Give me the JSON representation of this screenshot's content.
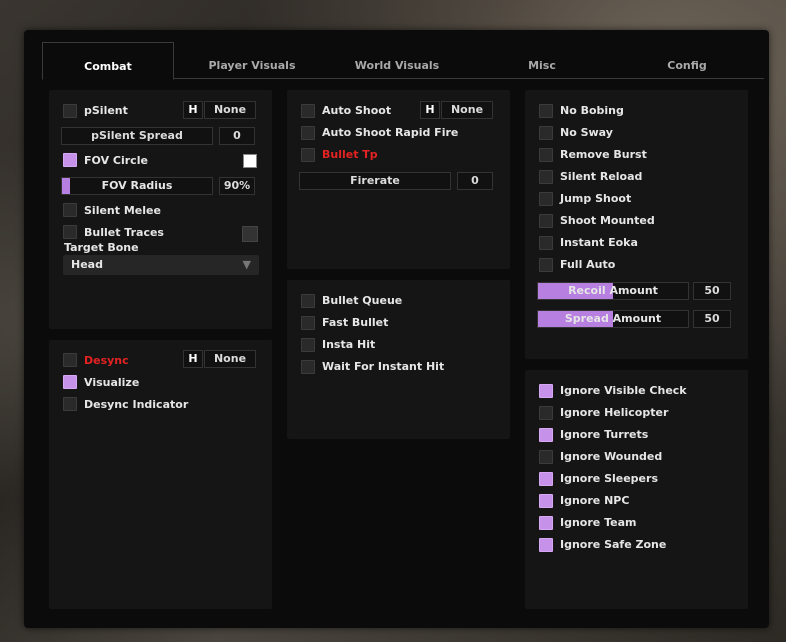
{
  "tabs": [
    {
      "label": "Combat",
      "active": true
    },
    {
      "label": "Player Visuals",
      "active": false
    },
    {
      "label": "World Visuals",
      "active": false
    },
    {
      "label": "Misc",
      "active": false
    },
    {
      "label": "Config",
      "active": false
    }
  ],
  "aim": {
    "psilent": {
      "label": "pSilent",
      "checked": false,
      "hotkey": "H",
      "bind": "None"
    },
    "psilent_spread": {
      "label": "pSilent Spread",
      "value": "0"
    },
    "fov_circle": {
      "label": "FOV Circle",
      "checked": true,
      "color": "#ffffff"
    },
    "fov_radius": {
      "label": "FOV Radius",
      "value": "90%",
      "fill": 0.05
    },
    "silent_melee": {
      "label": "Silent Melee",
      "checked": false
    },
    "bullet_traces": {
      "label": "Bullet Traces",
      "checked": false
    },
    "target_bone": {
      "label": "Target Bone",
      "value": "Head"
    }
  },
  "desync": {
    "desync": {
      "label": "Desync",
      "checked": false,
      "hotkey": "H",
      "bind": "None"
    },
    "visualize": {
      "label": "Visualize",
      "checked": true
    },
    "indicator": {
      "label": "Desync Indicator",
      "checked": false
    }
  },
  "shoot": {
    "auto_shoot": {
      "label": "Auto Shoot",
      "checked": false,
      "hotkey": "H",
      "bind": "None"
    },
    "rapid_fire": {
      "label": "Auto Shoot Rapid Fire",
      "checked": false
    },
    "bullet_tp": {
      "label": "Bullet Tp",
      "checked": false
    },
    "firerate": {
      "label": "Firerate",
      "value": "0"
    }
  },
  "bullet": {
    "queue": {
      "label": "Bullet Queue",
      "checked": false
    },
    "fast": {
      "label": "Fast Bullet",
      "checked": false
    },
    "insta": {
      "label": "Insta Hit",
      "checked": false
    },
    "wait": {
      "label": "Wait For Instant Hit",
      "checked": false
    }
  },
  "weapon": {
    "no_bobing": {
      "label": "No Bobing",
      "checked": false
    },
    "no_sway": {
      "label": "No Sway",
      "checked": false
    },
    "remove_burst": {
      "label": "Remove Burst",
      "checked": false
    },
    "silent_reload": {
      "label": "Silent Reload",
      "checked": false
    },
    "jump_shoot": {
      "label": "Jump Shoot",
      "checked": false
    },
    "shoot_mounted": {
      "label": "Shoot Mounted",
      "checked": false
    },
    "instant_eoka": {
      "label": "Instant Eoka",
      "checked": false
    },
    "full_auto": {
      "label": "Full Auto",
      "checked": false
    },
    "recoil": {
      "label": "Recoil Amount",
      "value": "50",
      "fill": 0.5
    },
    "spread": {
      "label": "Spread Amount",
      "value": "50",
      "fill": 0.5
    }
  },
  "ignore": {
    "visible": {
      "label": "Ignore Visible Check",
      "checked": true
    },
    "heli": {
      "label": "Ignore Helicopter",
      "checked": false
    },
    "turrets": {
      "label": "Ignore Turrets",
      "checked": true
    },
    "wounded": {
      "label": "Ignore Wounded",
      "checked": false
    },
    "sleepers": {
      "label": "Ignore Sleepers",
      "checked": true
    },
    "npc": {
      "label": "Ignore NPC",
      "checked": true
    },
    "team": {
      "label": "Ignore Team",
      "checked": true
    },
    "safe": {
      "label": "Ignore Safe Zone",
      "checked": true
    }
  }
}
